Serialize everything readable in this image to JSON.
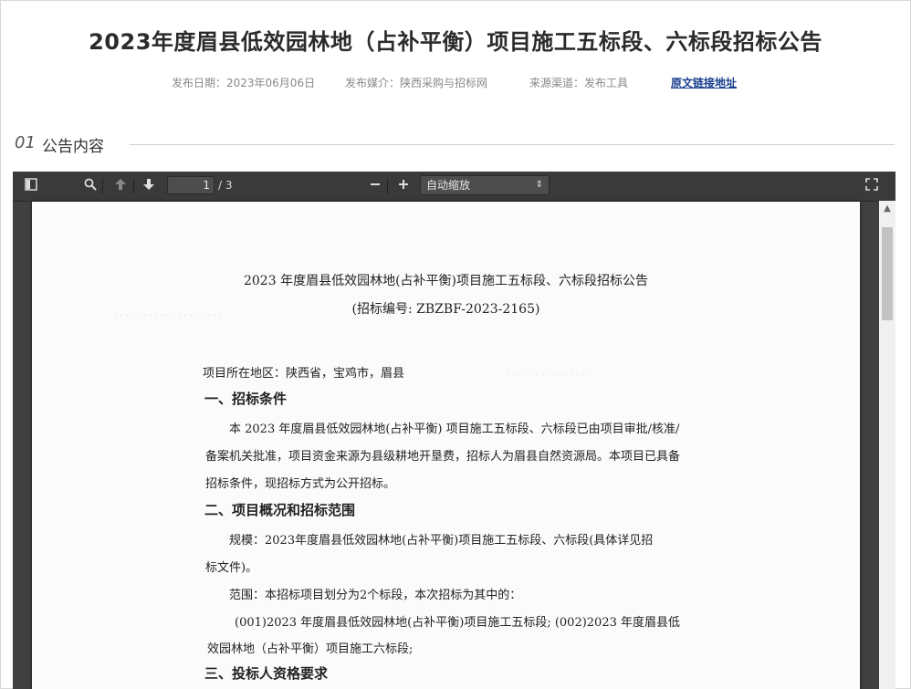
{
  "header": {
    "title": "2023年度眉县低效园林地（占补平衡）项目施工五标段、六标段招标公告",
    "publish_date": "发布日期：2023年06月06日",
    "publish_media": "发布媒介：陕西采购与招标网",
    "source_channel": "来源渠道：发布工具",
    "source_link": "原文链接地址"
  },
  "section": {
    "number": "01",
    "title": "公告内容"
  },
  "pdf_toolbar": {
    "page_current": "1",
    "page_total": "/ 3",
    "zoom": "自动缩放",
    "icons": [
      "sidebar-toggle-icon",
      "search-icon",
      "previous-page-icon",
      "next-page-icon",
      "zoom-out-icon",
      "zoom-in-icon",
      "fullscreen-icon"
    ]
  },
  "document": {
    "title": "2023 年度眉县低效园林地(占补平衡)项目施工五标段、六标段招标公告",
    "code": "(招标编号:  ZBZBF-2023-2165)",
    "location": "项目所在地区：陕西省，宝鸡市，眉县",
    "h1": "一、招标条件",
    "p1_l1": "本 2023 年度眉县低效园林地(占补平衡) 项目施工五标段、六标段已由项目审批/核准/",
    "p1_l2": "备案机关批准，项目资金来源为县级耕地开垦费，招标人为眉县自然资源局。本项目已具备",
    "p1_l3": "招标条件，现招标方式为公开招标。",
    "h2": "二、项目概况和招标范围",
    "p2_l1": "规模：2023年度眉县低效园林地(占补平衡)项目施工五标段、六标段(具体详见招",
    "p2_l2": "标文件)。",
    "p3_l1": "范围：本招标项目划分为2个标段，本次招标为其中的：",
    "p4_l1": "(001)2023 年度眉县低效园林地(占补平衡)项目施工五标段;  (002)2023  年度眉县低",
    "p4_l2": "效园林地（占补平衡）项目施工六标段;",
    "h3": "三、投标人资格要求"
  }
}
